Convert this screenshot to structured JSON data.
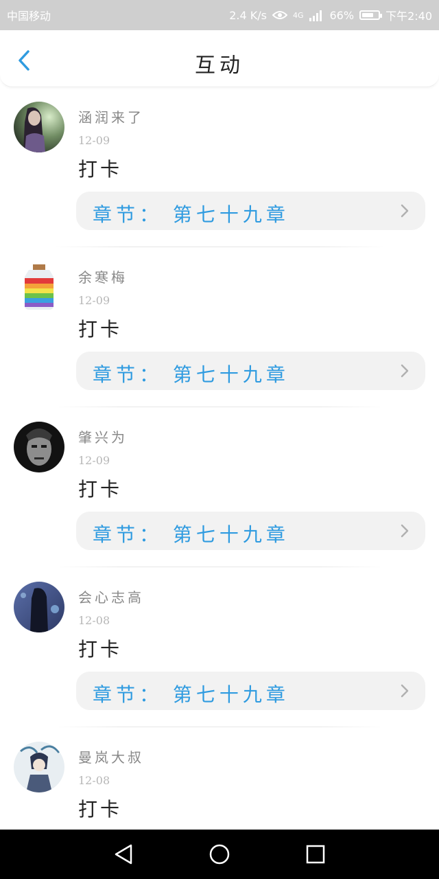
{
  "status_bar": {
    "carrier": "中国移动",
    "speed": "2.4 K/s",
    "network": "4G",
    "battery": "66%",
    "time": "下午2:40"
  },
  "header": {
    "title": "互动"
  },
  "items": [
    {
      "name": "涵润来了",
      "date": "12-09",
      "content": "打卡",
      "chapter": "章节：  第七十九章"
    },
    {
      "name": "余寒梅",
      "date": "12-09",
      "content": "打卡",
      "chapter": "章节：  第七十九章"
    },
    {
      "name": "肇兴为",
      "date": "12-09",
      "content": "打卡",
      "chapter": "章节：  第七十九章"
    },
    {
      "name": "会心志高",
      "date": "12-08",
      "content": "打卡",
      "chapter": "章节：  第七十九章"
    },
    {
      "name": "曼岚大叔",
      "date": "12-08",
      "content": "打卡"
    }
  ],
  "colors": {
    "accent": "#2f9be0",
    "navbar": "#000000",
    "statusbar": "#cfcfcf"
  },
  "icons": [
    "back-icon",
    "eye-icon",
    "signal-icon",
    "battery-icon",
    "chevron-right-icon",
    "nav-back-icon",
    "nav-home-icon",
    "nav-recents-icon"
  ]
}
